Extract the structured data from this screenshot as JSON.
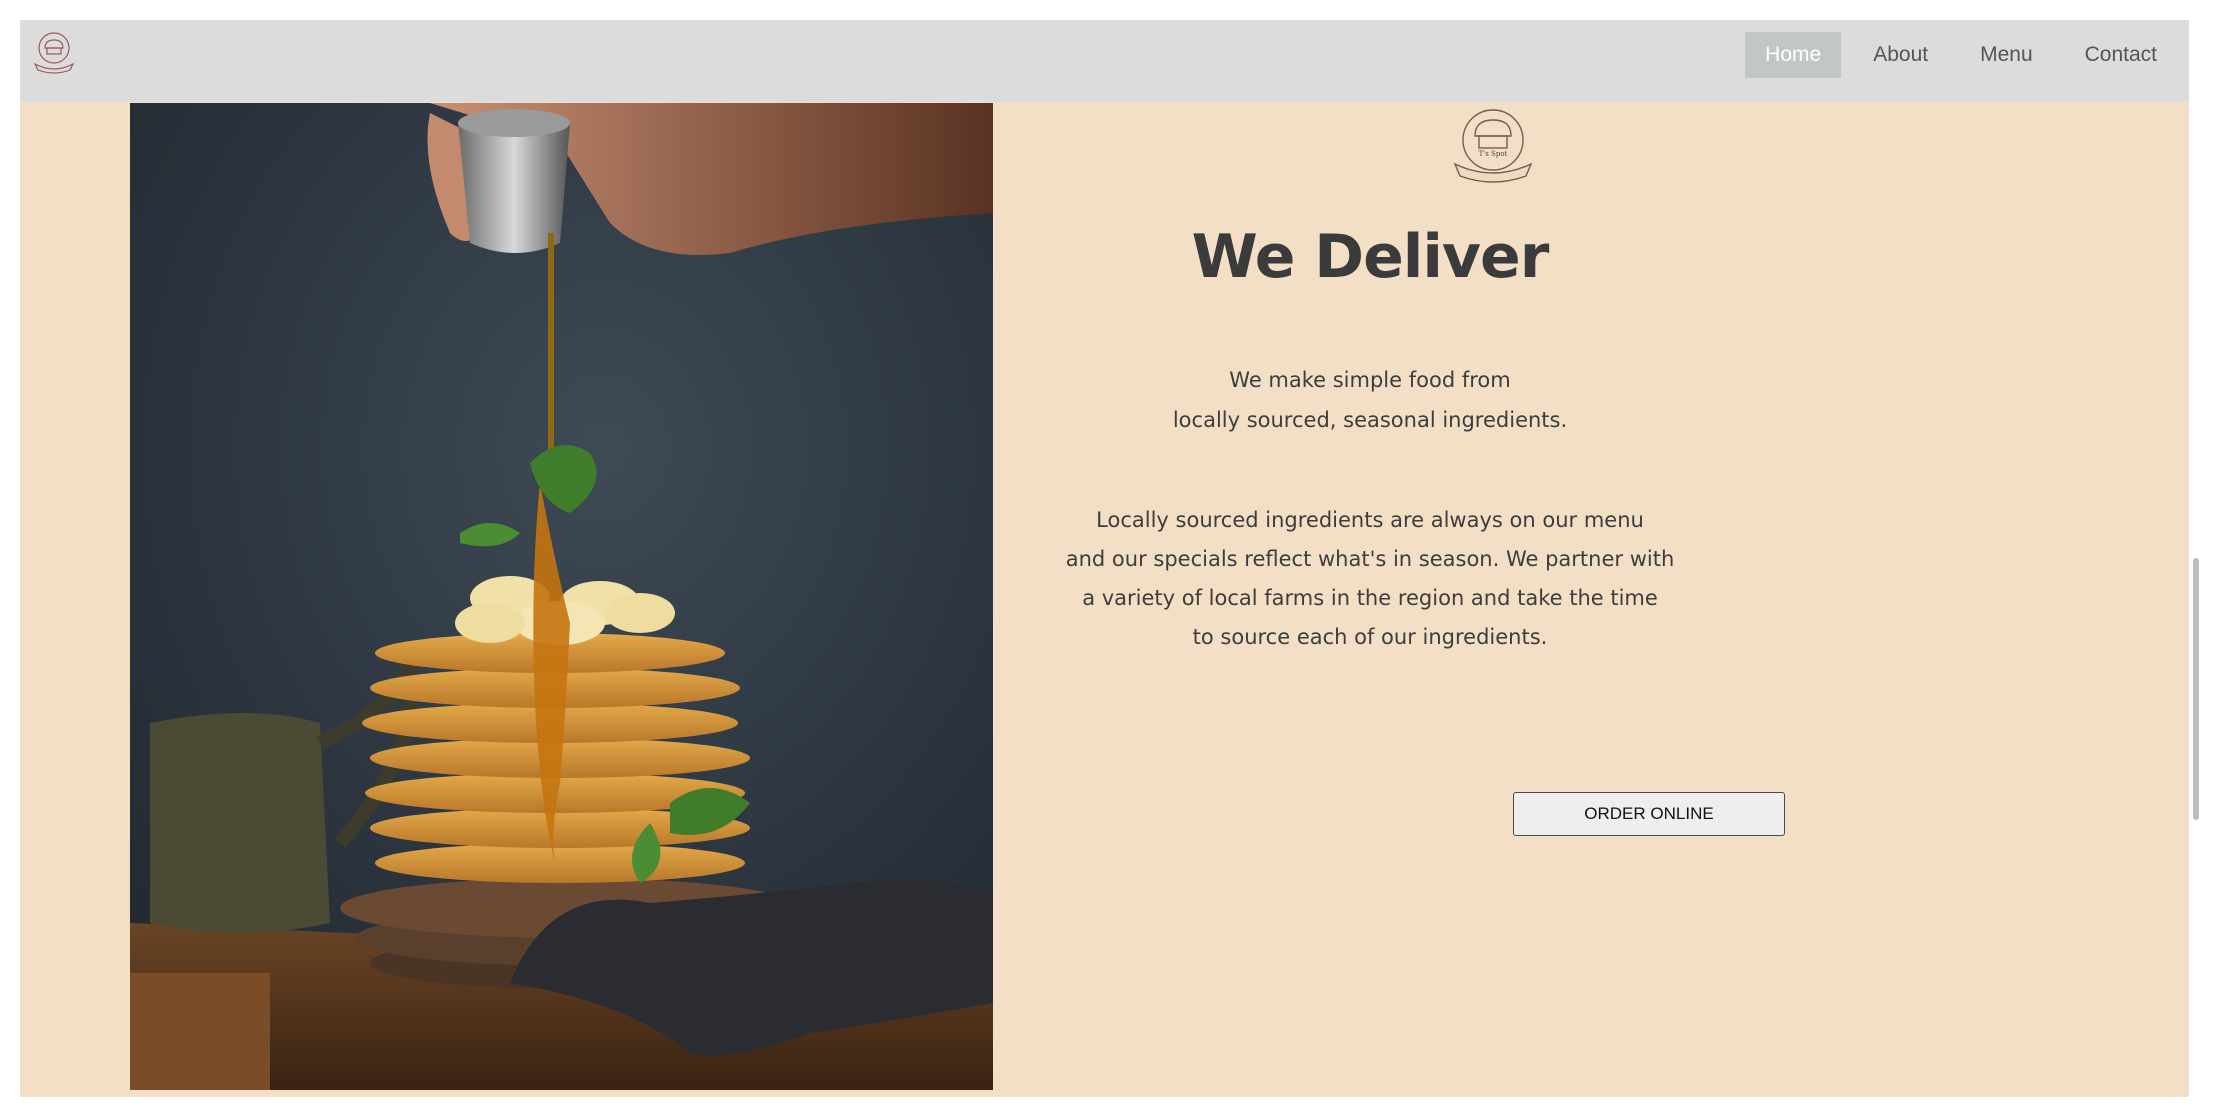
{
  "nav": {
    "logo_icon": "chef-hat-logo-icon",
    "links": [
      {
        "label": "Home",
        "active": true
      },
      {
        "label": "About",
        "active": false
      },
      {
        "label": "Menu",
        "active": false
      },
      {
        "label": "Contact",
        "active": false
      }
    ]
  },
  "hero": {
    "image": "pancake-stack-with-syrup-photo"
  },
  "content": {
    "logo_icon": "chef-hat-logo-icon",
    "title": "We Deliver",
    "tagline_lines": [
      "We make simple food from",
      "locally sourced, seasonal ingredients."
    ],
    "body_lines": [
      "Locally sourced ingredients are always on our menu",
      "and our specials reflect what's in season. We partner with",
      "a variety of local farms in the region and take the time",
      "to source each of our ingredients."
    ],
    "order_button": "ORDER ONLINE"
  },
  "colors": {
    "page_bg": "#f2dfc6",
    "nav_bg": "#dcdcdc",
    "nav_active_bg": "#c2c6c6",
    "text": "#3b3b3b"
  }
}
